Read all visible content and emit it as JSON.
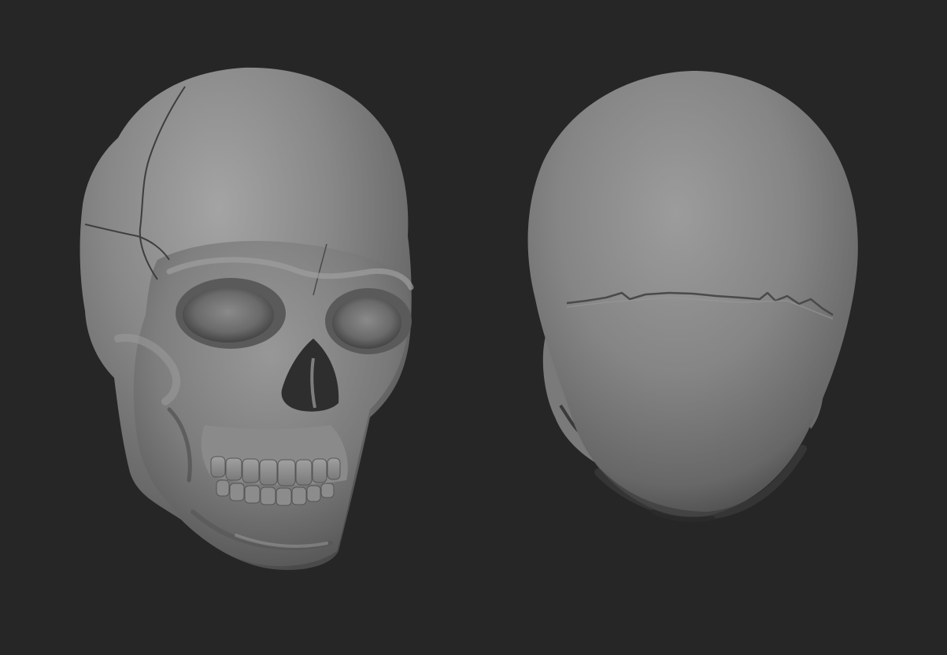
{
  "scene": {
    "background_color": "#262626",
    "material_color": "#7f7f7f",
    "highlight_color": "#a6a6a6",
    "shadow_color": "#2e2e2e",
    "objects": [
      {
        "name": "skull-front-three-quarter-view",
        "icon": "skull-front-icon"
      },
      {
        "name": "skull-back-view",
        "icon": "skull-back-icon"
      }
    ]
  }
}
